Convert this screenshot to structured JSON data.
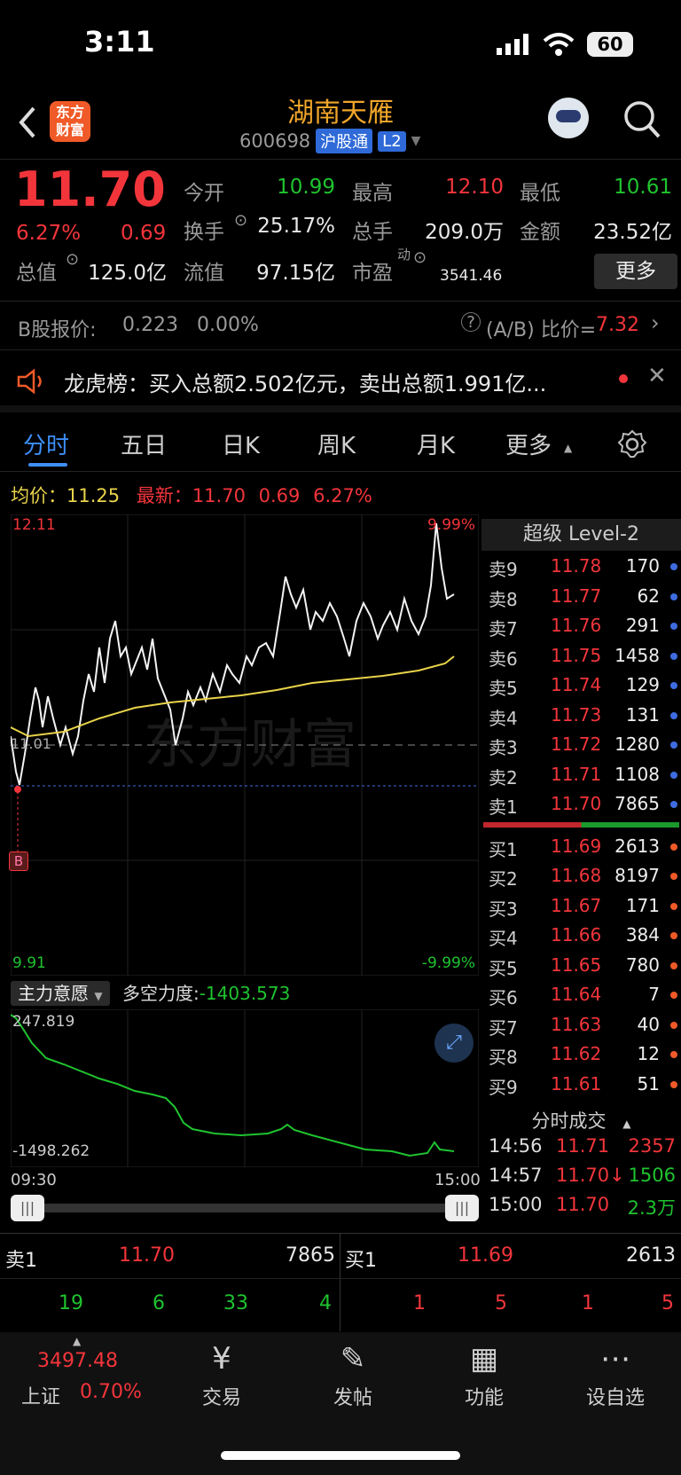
{
  "status_bar": {
    "time": "3:11",
    "battery": "60"
  },
  "header": {
    "stock_name": "湖南天雁",
    "stock_code": "600698",
    "tag1": "沪股通",
    "tag2": "L2",
    "logo_text_1": "东方",
    "logo_text_2": "财富"
  },
  "quote": {
    "price": "11.70",
    "change_pct": "6.27%",
    "change": "0.69",
    "open_label": "今开",
    "open": "10.99",
    "high_label": "最高",
    "high": "12.10",
    "low_label": "最低",
    "low": "10.61",
    "turnover_label": "换手",
    "turnover": "25.17%",
    "volume_label": "总手",
    "volume": "209.0万",
    "amount_label": "金额",
    "amount": "23.52亿",
    "mktcap_label": "总值",
    "mktcap": "125.0亿",
    "float_label": "流值",
    "float": "97.15亿",
    "pe_label": "市盈",
    "pe_sup": "动",
    "pe": "3541.46",
    "more": "更多"
  },
  "bshare": {
    "label": "B股报价:",
    "price": "0.223",
    "pct": "0.00%",
    "ratio_label": "(A/B) 比价=",
    "ratio": "7.32"
  },
  "news": {
    "text": "龙虎榜：买入总额2.502亿元，卖出总额1.991亿..."
  },
  "tabs": [
    "分时",
    "五日",
    "日K",
    "周K",
    "月K",
    "更多"
  ],
  "info_line": {
    "avg_label": "均价：",
    "avg": "11.25",
    "latest_label": "最新：",
    "latest": "11.70",
    "chg": "0.69",
    "pct": "6.27%"
  },
  "chart_labels": {
    "top_price": "12.11",
    "top_pct": "9.99%",
    "bottom_price": "9.91",
    "bottom_pct": "-9.99%",
    "mid": "11.01",
    "b_marker": "B",
    "watermark": "东方财富"
  },
  "indicator": {
    "name": "主力意愿",
    "metric_label": "多空力度:",
    "metric": "-1403.573",
    "max": "247.819",
    "min": "-1498.262",
    "start_time": "09:30",
    "end_time": "15:00"
  },
  "book": {
    "title": "超级 Level-2",
    "asks": [
      {
        "label": "卖9",
        "price": "11.78",
        "vol": "170"
      },
      {
        "label": "卖8",
        "price": "11.77",
        "vol": "62"
      },
      {
        "label": "卖7",
        "price": "11.76",
        "vol": "291"
      },
      {
        "label": "卖6",
        "price": "11.75",
        "vol": "1458"
      },
      {
        "label": "卖5",
        "price": "11.74",
        "vol": "129"
      },
      {
        "label": "卖4",
        "price": "11.73",
        "vol": "131"
      },
      {
        "label": "卖3",
        "price": "11.72",
        "vol": "1280"
      },
      {
        "label": "卖2",
        "price": "11.71",
        "vol": "1108"
      },
      {
        "label": "卖1",
        "price": "11.70",
        "vol": "7865"
      }
    ],
    "bids": [
      {
        "label": "买1",
        "price": "11.69",
        "vol": "2613"
      },
      {
        "label": "买2",
        "price": "11.68",
        "vol": "8197"
      },
      {
        "label": "买3",
        "price": "11.67",
        "vol": "171"
      },
      {
        "label": "买4",
        "price": "11.66",
        "vol": "384"
      },
      {
        "label": "买5",
        "price": "11.65",
        "vol": "780"
      },
      {
        "label": "买6",
        "price": "11.64",
        "vol": "7"
      },
      {
        "label": "买7",
        "price": "11.63",
        "vol": "40"
      },
      {
        "label": "买8",
        "price": "11.62",
        "vol": "12"
      },
      {
        "label": "买9",
        "price": "11.61",
        "vol": "51"
      }
    ]
  },
  "trades": {
    "title": "分时成交",
    "rows": [
      {
        "time": "14:56",
        "price": "11.71",
        "vol": "2357"
      },
      {
        "time": "14:57",
        "price": "11.70↓",
        "vol": "1506"
      },
      {
        "time": "15:00",
        "price": "11.70",
        "vol": "2.3万"
      }
    ]
  },
  "level1": {
    "ask_label": "卖1",
    "ask_price": "11.70",
    "ask_vol": "7865",
    "bid_label": "买1",
    "bid_price": "11.69",
    "bid_vol": "2613",
    "ask_counts": [
      "19",
      "6",
      "33",
      "4"
    ],
    "bid_counts": [
      "1",
      "5",
      "1",
      "5"
    ]
  },
  "footer": {
    "index_value": "3497.48",
    "index_name": "上证",
    "index_pct": "0.70%",
    "nav": [
      "交易",
      "发帖",
      "功能",
      "设自选"
    ]
  },
  "colors": {
    "up": "#f2353b",
    "down": "#1fc32f",
    "avg_line": "#e8d34a",
    "accent": "#3e8ef7",
    "brand": "#f0a52a"
  }
}
